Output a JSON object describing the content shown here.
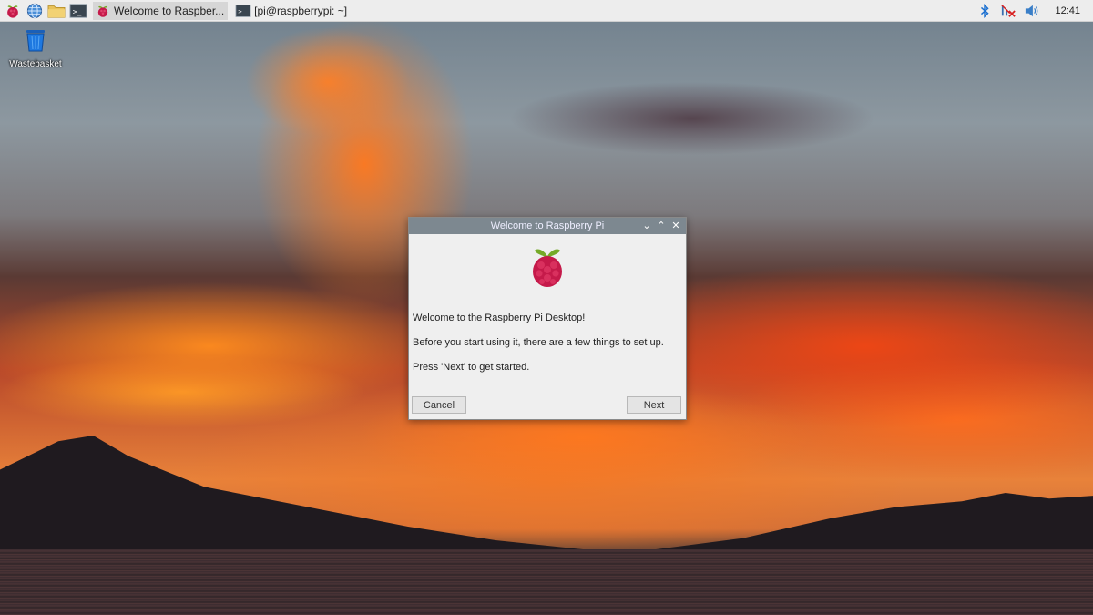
{
  "taskbar": {
    "launchers": [
      {
        "icon": "raspberry-menu-icon"
      },
      {
        "icon": "web-browser-icon"
      },
      {
        "icon": "file-manager-icon"
      },
      {
        "icon": "terminal-icon"
      }
    ],
    "windows": [
      {
        "label": "Welcome to Raspber...",
        "icon": "raspberry-icon",
        "active": true
      },
      {
        "label": "[pi@raspberrypi: ~]",
        "icon": "terminal-icon",
        "active": false
      }
    ],
    "tray": {
      "bluetooth_icon": "bluetooth-icon",
      "network_icon": "network-disconnected-icon",
      "volume_icon": "volume-icon",
      "clock": "12:41"
    }
  },
  "desktop": {
    "icons": [
      {
        "label": "Wastebasket",
        "icon": "wastebasket-icon"
      }
    ]
  },
  "dialog": {
    "title": "Welcome to Raspberry Pi",
    "line1": "Welcome to the Raspberry Pi Desktop!",
    "line2": "Before you start using it, there are a few things to set up.",
    "line3": "Press 'Next' to get started.",
    "cancel_label": "Cancel",
    "next_label": "Next",
    "controls": {
      "minimize": "⌄",
      "maximize": "⌃",
      "close": "✕"
    }
  },
  "colors": {
    "accent_raspberry": "#c51a4a",
    "leaf_green": "#75a928",
    "titlebar": "#7d8890"
  }
}
